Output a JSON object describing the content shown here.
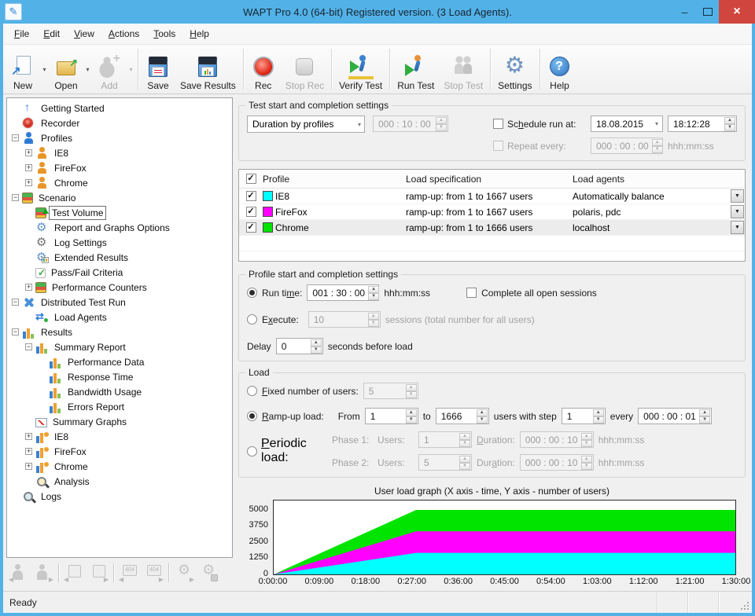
{
  "window": {
    "title": "WAPT Pro 4.0 (64-bit) Registered version. (3 Load Agents)."
  },
  "menu": {
    "items": [
      {
        "name": "file",
        "label_html": "<u>F</u>ile"
      },
      {
        "name": "edit",
        "label_html": "<u>E</u>dit"
      },
      {
        "name": "view",
        "label_html": "<u>V</u>iew"
      },
      {
        "name": "actions",
        "label_html": "<u>A</u>ctions"
      },
      {
        "name": "tools",
        "label_html": "<u>T</u>ools"
      },
      {
        "name": "help",
        "label_html": "<u>H</u>elp"
      }
    ]
  },
  "toolbar": {
    "items": [
      {
        "name": "new",
        "label": "New",
        "icon": "new",
        "enabled": true,
        "dropdown": true
      },
      {
        "name": "open",
        "label": "Open",
        "icon": "open",
        "enabled": true,
        "dropdown": true
      },
      {
        "name": "add",
        "label": "Add",
        "icon": "add",
        "enabled": false,
        "dropdown": true
      },
      {
        "type": "separator"
      },
      {
        "name": "save",
        "label": "Save",
        "icon": "save",
        "enabled": true
      },
      {
        "name": "save-results",
        "label": "Save Results",
        "icon": "saver",
        "enabled": true
      },
      {
        "type": "separator"
      },
      {
        "name": "rec",
        "label": "Rec",
        "icon": "rec",
        "enabled": true
      },
      {
        "name": "stop-rec",
        "label": "Stop Rec",
        "icon": "stoprec",
        "enabled": false
      },
      {
        "type": "separator"
      },
      {
        "name": "verify-test",
        "label": "Verify Test",
        "icon": "verify",
        "enabled": true
      },
      {
        "type": "separator"
      },
      {
        "name": "run-test",
        "label": "Run Test",
        "icon": "run",
        "enabled": true
      },
      {
        "name": "stop-test",
        "label": "Stop Test",
        "icon": "stopt",
        "enabled": false
      },
      {
        "type": "separator"
      },
      {
        "name": "settings",
        "label": "Settings",
        "icon": "gear",
        "enabled": true
      },
      {
        "type": "separator"
      },
      {
        "name": "help",
        "label": "Help",
        "icon": "help",
        "enabled": true
      }
    ]
  },
  "sidebar": {
    "items": [
      {
        "label": "Getting Started",
        "icon": "up",
        "level": 0,
        "expander": null,
        "selected": false
      },
      {
        "label": "Recorder",
        "icon": "rec",
        "level": 0,
        "expander": null,
        "selected": false
      },
      {
        "label": "Profiles",
        "icon": "person-blue",
        "level": 0,
        "expander": "minus",
        "selected": false
      },
      {
        "label": "IE8",
        "icon": "person-orange",
        "level": 1,
        "expander": "plus",
        "selected": false
      },
      {
        "label": "FireFox",
        "icon": "person-orange",
        "level": 1,
        "expander": "plus",
        "selected": false
      },
      {
        "label": "Chrome",
        "icon": "person-orange",
        "level": 1,
        "expander": "plus",
        "selected": false
      },
      {
        "label": "Scenario",
        "icon": "books",
        "level": 0,
        "expander": "minus",
        "selected": false
      },
      {
        "label": "Test Volume",
        "icon": "books-vol",
        "level": 1,
        "expander": null,
        "selected": true
      },
      {
        "label": "Report and Graphs Options",
        "icon": "gear-blue",
        "level": 1,
        "expander": null,
        "selected": false
      },
      {
        "label": "Log Settings",
        "icon": "gear-dark",
        "level": 1,
        "expander": null,
        "selected": false
      },
      {
        "label": "Extended Results",
        "icon": "gear-chart",
        "level": 1,
        "expander": null,
        "selected": false
      },
      {
        "label": "Pass/Fail Criteria",
        "icon": "check",
        "level": 1,
        "expander": null,
        "selected": false
      },
      {
        "label": "Performance Counters",
        "icon": "books",
        "level": 1,
        "expander": "plus",
        "selected": false
      },
      {
        "label": "Distributed Test Run",
        "icon": "dist",
        "level": 0,
        "expander": "minus",
        "selected": false
      },
      {
        "label": "Load Agents",
        "icon": "runners",
        "level": 1,
        "expander": null,
        "selected": false
      },
      {
        "label": "Results",
        "icon": "chart",
        "level": 0,
        "expander": "minus",
        "selected": false
      },
      {
        "label": "Summary Report",
        "icon": "chart",
        "level": 1,
        "expander": "minus",
        "selected": false
      },
      {
        "label": "Performance Data",
        "icon": "chart",
        "level": 2,
        "expander": null,
        "selected": false
      },
      {
        "label": "Response Time",
        "icon": "chart",
        "level": 2,
        "expander": null,
        "selected": false
      },
      {
        "label": "Bandwidth Usage",
        "icon": "chart",
        "level": 2,
        "expander": null,
        "selected": false
      },
      {
        "label": "Errors Report",
        "icon": "chart",
        "level": 2,
        "expander": null,
        "selected": false
      },
      {
        "label": "Summary Graphs",
        "icon": "graph",
        "level": 1,
        "expander": null,
        "selected": false
      },
      {
        "label": "IE8",
        "icon": "chart-person",
        "level": 1,
        "expander": "plus",
        "selected": false
      },
      {
        "label": "FireFox",
        "icon": "chart-person",
        "level": 1,
        "expander": "plus",
        "selected": false
      },
      {
        "label": "Chrome",
        "icon": "chart-person",
        "level": 1,
        "expander": "plus",
        "selected": false
      },
      {
        "label": "Analysis",
        "icon": "magnifier-chart",
        "level": 1,
        "expander": null,
        "selected": false
      },
      {
        "label": "Logs",
        "icon": "magnifier",
        "level": 0,
        "expander": null,
        "selected": false
      }
    ],
    "bottom_toolbar": [
      [
        "user-back",
        "user-forward"
      ],
      [
        "session-back",
        "session-forward"
      ],
      [
        "page404-back",
        "page404-forward"
      ],
      [
        "gear-run",
        "gear-lock"
      ]
    ]
  },
  "test_start": {
    "title": "Test start and completion settings",
    "mode_value": "Duration by profiles",
    "duration_value": "000 : 10 : 00",
    "schedule_label_html": "Sc<u>h</u>edule run at:",
    "schedule_date": "18.08.2015",
    "schedule_time": "18:12:28",
    "repeat_label": "Repeat every:",
    "repeat_value": "000 : 00 : 00",
    "repeat_unit": "hhh:mm:ss"
  },
  "profiles_table": {
    "headers": [
      "Profile",
      "Load specification",
      "Load agents"
    ],
    "rows": [
      {
        "checked": true,
        "color": "#00FFFF",
        "name": "IE8",
        "spec": "ramp-up: from 1 to 1667 users",
        "agents": "Automatically balance",
        "selected": false
      },
      {
        "checked": true,
        "color": "#FF00FF",
        "name": "FireFox",
        "spec": "ramp-up: from 1 to 1667 users",
        "agents": "polaris, pdc",
        "selected": false
      },
      {
        "checked": true,
        "color": "#00E400",
        "name": "Chrome",
        "spec": "ramp-up: from 1 to 1666 users",
        "agents": "localhost",
        "selected": true
      }
    ]
  },
  "profile_start": {
    "title": "Profile start and completion settings",
    "run_time": {
      "label_html": "Run ti<u>m</u>e:",
      "value": "001 : 30 : 00",
      "unit": "hhh:mm:ss",
      "sessions_label": "Complete all open sessions"
    },
    "execute": {
      "label_html": "E<u>x</u>ecute:",
      "value": "10",
      "note": "sessions (total number for all users)"
    },
    "delay": {
      "label": "Delay",
      "value": "0",
      "note": "seconds before load"
    }
  },
  "load": {
    "title": "Load",
    "fixed": {
      "label_html": "<u>F</u>ixed number of users:",
      "value": "5"
    },
    "ramp": {
      "label_html": "<u>R</u>amp-up load:",
      "from_label": "From",
      "from": "1",
      "to_label": "to",
      "to": "1666",
      "step_label": "users with step",
      "step": "1",
      "every_label": "every",
      "every": "000 : 00 : 01"
    },
    "periodic": {
      "label_html": "<u>P</u>eriodic load:",
      "phases": [
        {
          "label": "Phase 1:",
          "users_label": "Users:",
          "users": "1",
          "duration_label_html": "<u>D</u>uration:",
          "duration": "000 : 00 : 10",
          "unit": "hhh:mm:ss"
        },
        {
          "label": "Phase 2:",
          "users_label": "Users:",
          "users": "5",
          "duration_label_html": "Dur<u>a</u>tion:",
          "duration": "000 : 00 : 10",
          "unit": "hhh:mm:ss"
        }
      ]
    }
  },
  "chart_data": {
    "type": "area",
    "title": "User load graph (X axis - time, Y axis - number of users)",
    "xlabel": "time",
    "ylabel": "number of users",
    "x_ticks": [
      "0:00:00",
      "0:09:00",
      "0:18:00",
      "0:27:00",
      "0:36:00",
      "0:45:00",
      "0:54:00",
      "1:03:00",
      "1:12:00",
      "1:21:00",
      "1:30:00"
    ],
    "y_ticks": [
      0,
      1250,
      2500,
      3750,
      5000
    ],
    "x_range_seconds": [
      0,
      5400
    ],
    "y_max": 5730,
    "ramp_end_seconds": 1666,
    "series": [
      {
        "name": "IE8",
        "color": "#00FFFF",
        "users": 1667
      },
      {
        "name": "FireFox",
        "color": "#FF00FF",
        "users": 1667
      },
      {
        "name": "Chrome",
        "color": "#00E400",
        "users": 1666
      }
    ]
  },
  "status": {
    "text": "Ready"
  }
}
